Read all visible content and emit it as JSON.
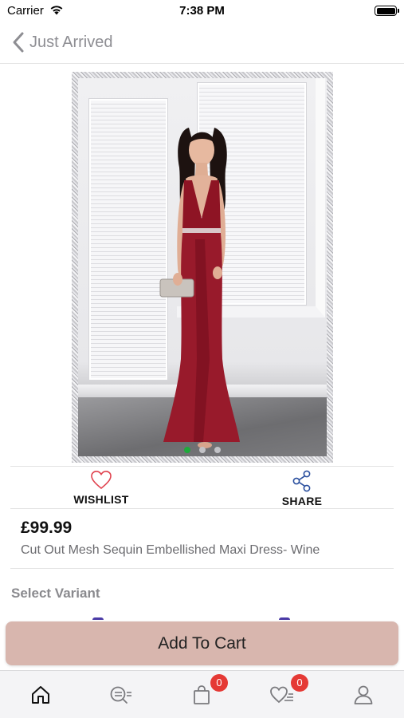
{
  "status_bar": {
    "carrier": "Carrier",
    "time": "7:38 PM"
  },
  "nav": {
    "back_label": "Just Arrived"
  },
  "gallery": {
    "image_count": 3,
    "active_index": 0,
    "accent_color": "#1faa3b"
  },
  "actions": {
    "wishlist_label": "WISHLIST",
    "share_label": "SHARE"
  },
  "product": {
    "price": "£99.99",
    "title": "Cut Out Mesh Sequin Embellished Maxi Dress- Wine"
  },
  "variant": {
    "label": "Select Variant"
  },
  "cart_button": {
    "label": "Add To Cart",
    "color": "#d8b6ae"
  },
  "tab_bar": {
    "tabs": [
      {
        "icon": "home-icon"
      },
      {
        "icon": "search-icon"
      },
      {
        "icon": "shopping-bag-icon",
        "badge": "0"
      },
      {
        "icon": "wishlist-icon",
        "badge": "0"
      },
      {
        "icon": "profile-icon"
      }
    ],
    "badge_color": "#e53935"
  }
}
